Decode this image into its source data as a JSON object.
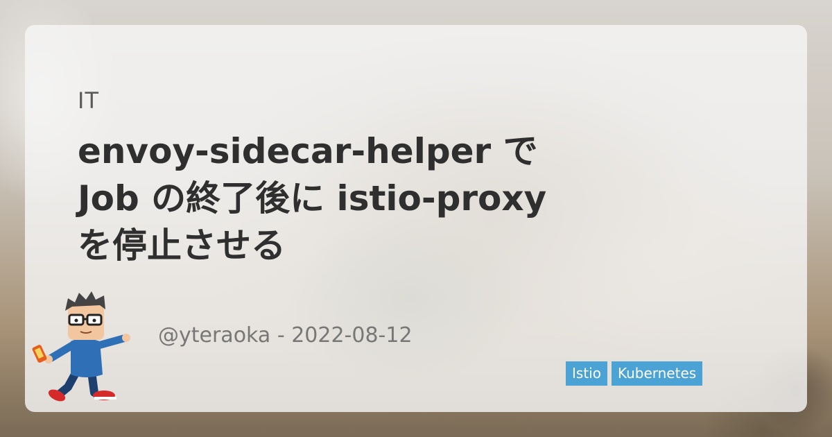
{
  "category": "IT",
  "title_lines": [
    "envoy-sidecar-helper で",
    "Job の終了後に istio-proxy",
    "を停止させる"
  ],
  "meta": {
    "author": "@yteraoka",
    "separator": " - ",
    "date": "2022-08-12"
  },
  "tags": [
    "Istio",
    "Kubernetes"
  ],
  "colors": {
    "tag_bg": "#4aa3d4",
    "title": "#2f2f2f",
    "meta": "#777777"
  },
  "avatar_icon": "cartoon-person-avatar"
}
